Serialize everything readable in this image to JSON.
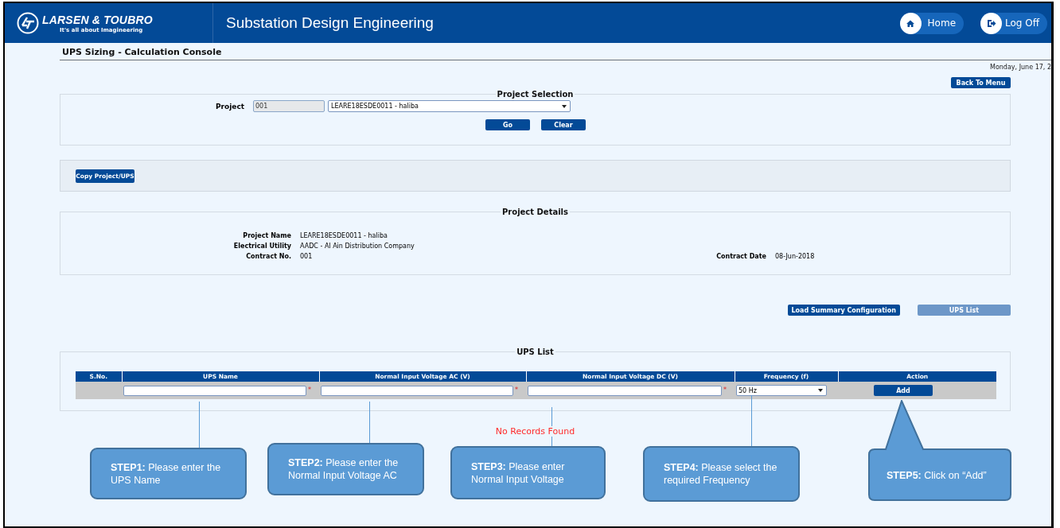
{
  "header": {
    "brand": "LARSEN & TOUBRO",
    "tagline": "It's all about Imagineering",
    "app_title": "Substation Design Engineering",
    "buttons": [
      {
        "label": "Home",
        "kind": "home"
      },
      {
        "label": "Log Off",
        "kind": "logoff"
      }
    ]
  },
  "page": {
    "title": "UPS Sizing - Calculation Console",
    "date": "Monday, June 17, 2",
    "back_button": "Back To Menu"
  },
  "project_selection": {
    "legend": "Project Selection",
    "label": "Project",
    "code": {
      "value": "001",
      "disabled": true
    },
    "project": {
      "value": "LEARE18ESDE0011 - haliba"
    },
    "buttons": [
      "Go",
      "Clear"
    ]
  },
  "copy_panel": {
    "button": "Copy Project/UPS"
  },
  "project_details": {
    "legend": "Project Details",
    "fields": [
      {
        "label": "Project Name",
        "value": "LEARE18ESDE0011 - haliba"
      },
      {
        "label": "Electrical Utility",
        "value": "AADC - Al Ain Distribution Company"
      },
      {
        "label": "Contract No.",
        "value": "001"
      }
    ],
    "contract_date": {
      "label": "Contract Date",
      "value": "08-Jun-2018"
    }
  },
  "view_buttons": [
    {
      "label": "Load Summary Configuration",
      "selected": false
    },
    {
      "label": "UPS List",
      "selected": true
    }
  ],
  "ups_list": {
    "legend": "UPS List",
    "columns": [
      "S.No.",
      "UPS Name",
      "Normal Input Voltage AC (V)",
      "Normal Input Voltage DC (V)",
      "Frequency (f)",
      "Action"
    ],
    "entry_row": [
      {
        "kind": "empty"
      },
      {
        "kind": "text",
        "required_mark": "*"
      },
      {
        "kind": "text",
        "required_mark": "*"
      },
      {
        "kind": "text",
        "required_mark": "*"
      },
      {
        "kind": "select",
        "value": "50 Hz"
      },
      {
        "kind": "button",
        "label": "Add"
      }
    ],
    "empty_message": "No Records Found"
  },
  "steps": [
    {
      "kind": "line",
      "text": "**STEP1:** Please enter the UPS Name"
    },
    {
      "kind": "line",
      "text": "**STEP2:** Please enter the Normal Input Voltage AC"
    },
    {
      "kind": "line",
      "text": "**STEP3:** Please enter Normal Input Voltage"
    },
    {
      "kind": "line",
      "text": "**STEP4:** Please select the required Frequency"
    },
    {
      "kind": "pointer",
      "text": "**STEP5:** Click on “Add”"
    }
  ]
}
